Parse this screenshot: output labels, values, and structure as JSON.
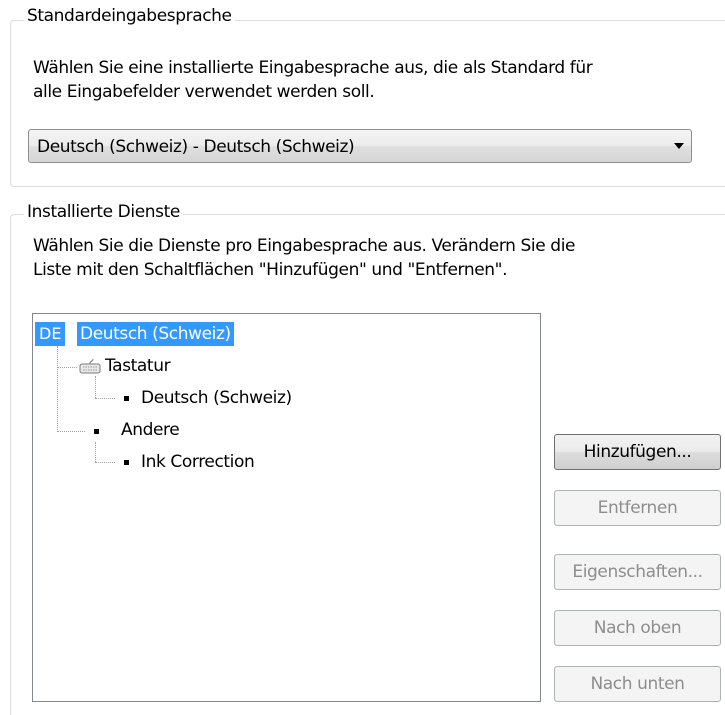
{
  "standard_language": {
    "group_label": "Standardeingabesprache",
    "description_line1": "Wählen Sie eine installierte Eingabesprache aus, die als Standard für",
    "description_line2": "alle Eingabefelder verwendet werden soll.",
    "selected_value": "Deutsch (Schweiz) - Deutsch (Schweiz)"
  },
  "installed_services": {
    "group_label": "Installierte Dienste",
    "description_line1": "Wählen Sie die Dienste pro Eingabesprache aus. Verändern Sie die",
    "description_line2": "Liste mit den Schaltflächen \"Hinzufügen\" und \"Entfernen\".",
    "tree": {
      "language_badge": "DE",
      "language_label": "Deutsch (Schweiz)",
      "keyboard_label": "Tastatur",
      "keyboard_layout": "Deutsch (Schweiz)",
      "other_label": "Andere",
      "other_item": "Ink Correction",
      "keyboard_icon": "keyboard-icon"
    },
    "buttons": {
      "add": "Hinzufügen...",
      "remove": "Entfernen",
      "properties": "Eigenschaften...",
      "move_up": "Nach oben",
      "move_down": "Nach unten"
    }
  },
  "colors": {
    "selection": "#3399ff",
    "disabled_text": "#8d8d8d",
    "group_border": "#dcdcdc"
  }
}
